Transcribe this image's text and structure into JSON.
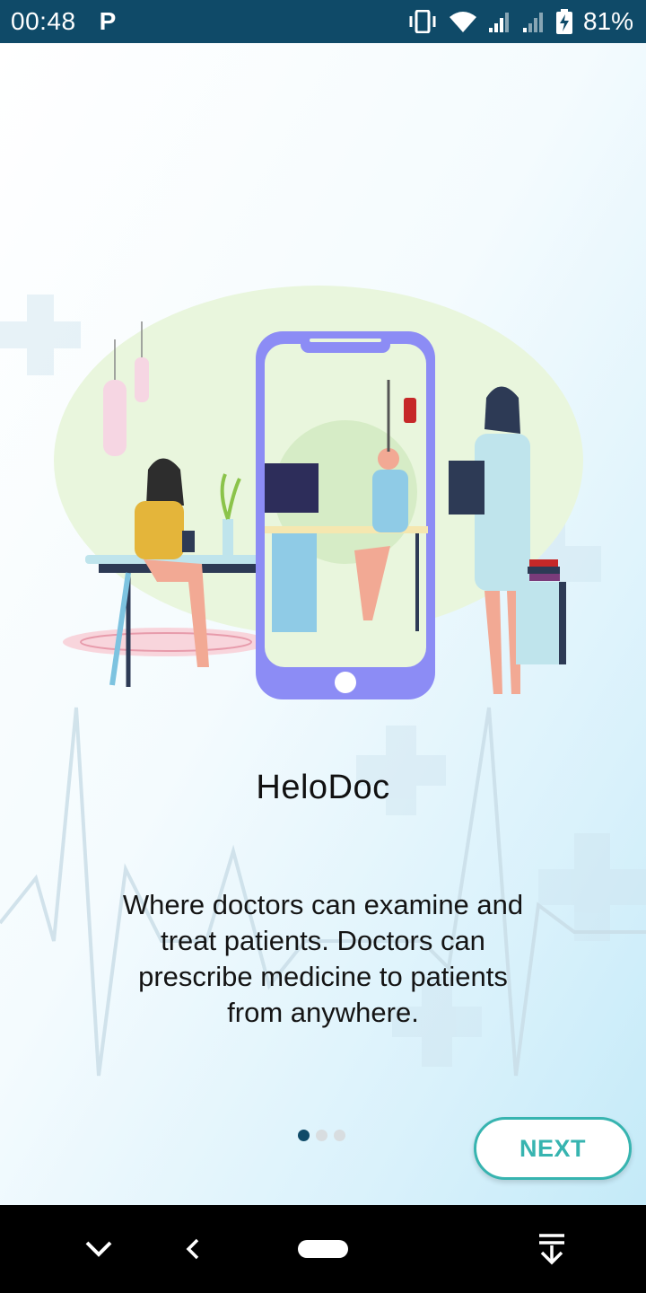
{
  "status_bar": {
    "time": "00:48",
    "notification_icon": "parking-p-icon",
    "icons": [
      "vibrate-icon",
      "wifi-icon",
      "signal-icon",
      "signal-weak-icon",
      "battery-charging-icon"
    ],
    "battery_percent": "81%"
  },
  "onboarding": {
    "title": "HeloDoc",
    "description": "Where doctors can examine and treat patients. Doctors can prescribe medicine to patients from anywhere.",
    "pages_total": 3,
    "current_page": 1,
    "next_label": "NEXT"
  },
  "nav_bar": {
    "icons": [
      "chevron-down-icon",
      "back-icon",
      "home-pill-icon",
      "download-icon"
    ]
  },
  "colors": {
    "status_bar": "#0f4a68",
    "accent_teal": "#37b4b0",
    "dot_active": "#0f4a68",
    "dot_inactive": "#d8dde0",
    "phone_purple": "#8c8cf5"
  }
}
